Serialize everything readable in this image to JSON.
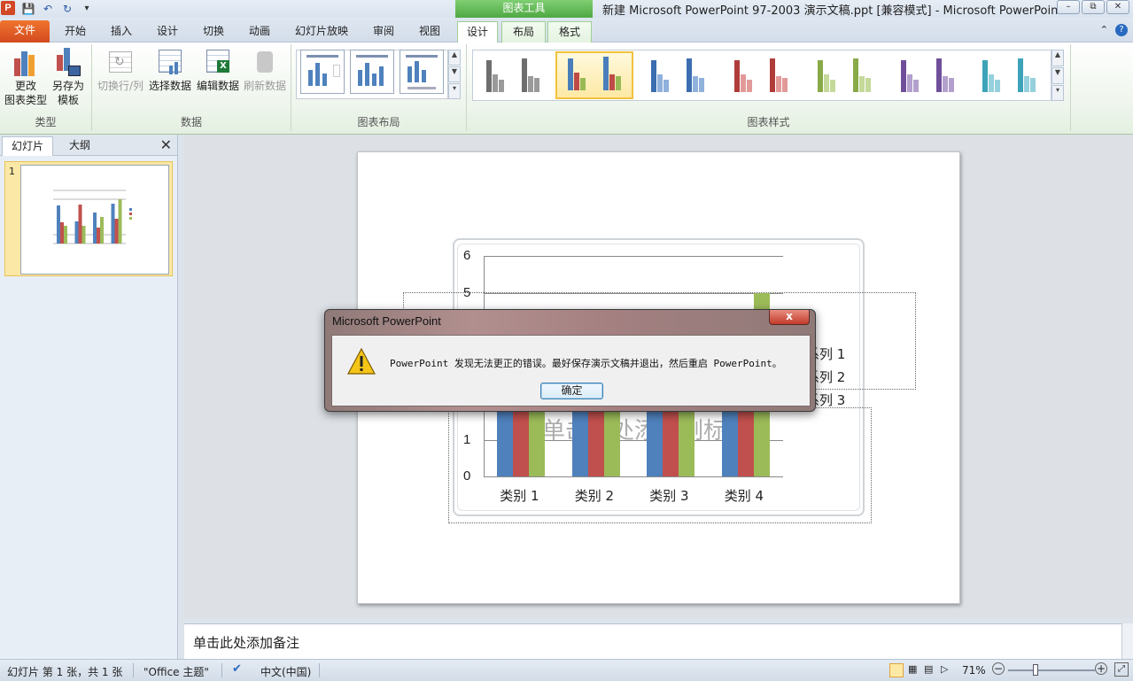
{
  "app": {
    "icon_letter": "P",
    "context_tool": "图表工具",
    "window_title": "新建 Microsoft PowerPoint 97-2003 演示文稿.ppt [兼容模式] - Microsoft PowerPoint"
  },
  "tabs": [
    {
      "label": "文件"
    },
    {
      "label": "开始"
    },
    {
      "label": "插入"
    },
    {
      "label": "设计"
    },
    {
      "label": "切换"
    },
    {
      "label": "动画"
    },
    {
      "label": "幻灯片放映"
    },
    {
      "label": "审阅"
    },
    {
      "label": "视图"
    },
    {
      "label": "设计"
    },
    {
      "label": "布局"
    },
    {
      "label": "格式"
    }
  ],
  "ribbon": {
    "type_group": {
      "label": "类型",
      "change_type": [
        "更改",
        "图表类型"
      ],
      "save_template": [
        "另存为",
        "模板"
      ]
    },
    "data_group": {
      "label": "数据",
      "switch_row_col": "切换行/列",
      "select_data": "选择数据",
      "edit_data": "编辑数据",
      "refresh_data": "刷新数据"
    },
    "layout_group": {
      "label": "图表布局"
    },
    "style_group": {
      "label": "图表样式"
    }
  },
  "chart_styles": [
    {
      "c1": "#6e6e6e",
      "c2": "#9a9a9a"
    },
    {
      "c1": "#4a7ebb",
      "c2": "#be4b48",
      "c3": "#98b954",
      "selected": true
    },
    {
      "c1": "#3c6db0",
      "c2": "#8fb1dc"
    },
    {
      "c1": "#b03c3a",
      "c2": "#e29a99"
    },
    {
      "c1": "#88aa48",
      "c2": "#c4d99a"
    },
    {
      "c1": "#6f4f9a",
      "c2": "#b3a0cc"
    },
    {
      "c1": "#3ca3b8",
      "c2": "#95d0dd"
    }
  ],
  "left_panel": {
    "tab_slides": "幻灯片",
    "tab_outline": "大纲",
    "slide_number": "1"
  },
  "chart_data": {
    "type": "bar",
    "categories": [
      "类别 1",
      "类别 2",
      "类别 3",
      "类别 4"
    ],
    "series": [
      {
        "name": "系列 1",
        "color": "#4f81bd",
        "values": [
          4.3,
          2.5,
          3.5,
          4.5
        ]
      },
      {
        "name": "系列 2",
        "color": "#c0504d",
        "values": [
          2.4,
          4.4,
          1.8,
          2.8
        ]
      },
      {
        "name": "系列 3",
        "color": "#9bbb59",
        "values": [
          2.0,
          2.0,
          3.0,
          5.0
        ]
      }
    ],
    "yticks": [
      "0",
      "1",
      "5",
      "6"
    ],
    "ylim": [
      0,
      6
    ],
    "grid": true,
    "legend_position": "right"
  },
  "notes": {
    "placeholder": "单击此处添加备注"
  },
  "status": {
    "slide_info": "幻灯片 第 1 张，共 1 张",
    "theme": "\"Office 主题\"",
    "language": "中文(中国)",
    "zoom": "71%"
  },
  "dialog": {
    "title": "Microsoft PowerPoint",
    "message": "PowerPoint 发现无法更正的错误。最好保存演示文稿并退出，然后重启 PowerPoint。",
    "ok_label": "确定",
    "close_glyph": "x"
  }
}
